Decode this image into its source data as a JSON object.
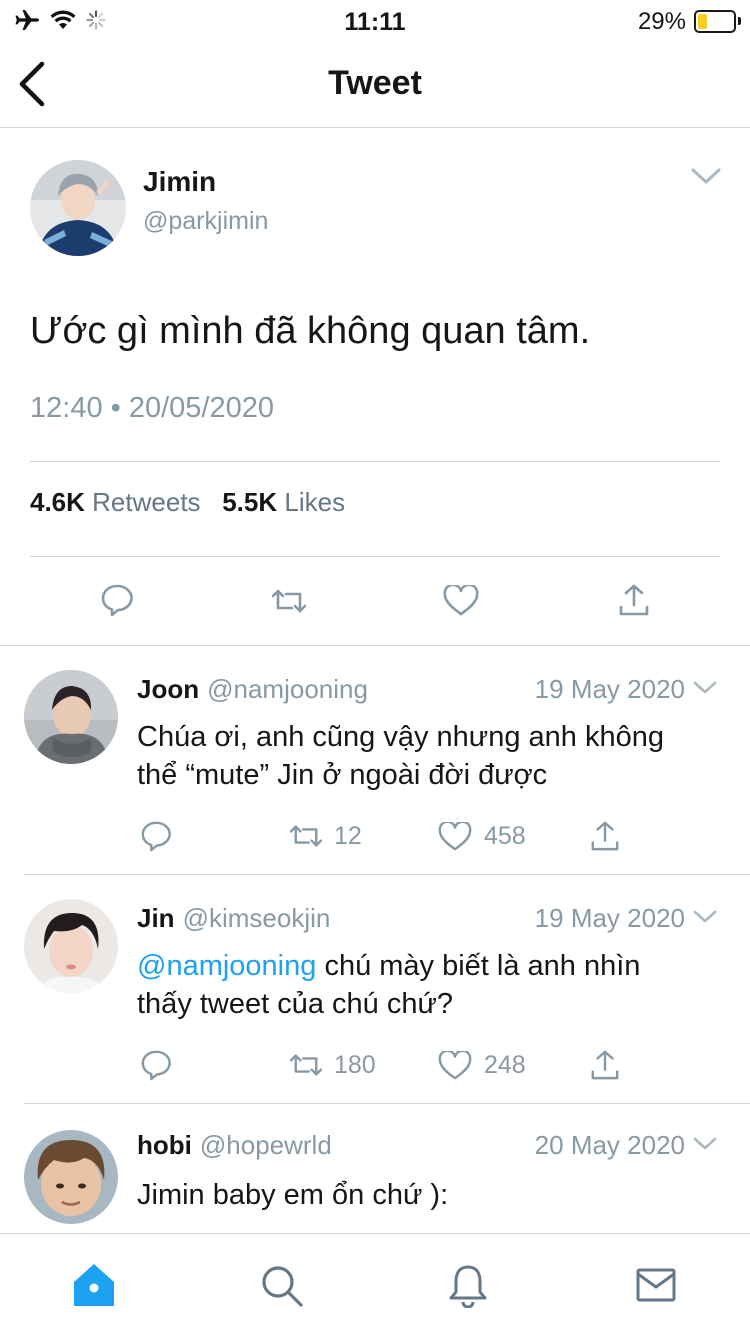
{
  "status_bar": {
    "time": "11:11",
    "battery_percent": "29%",
    "battery_level": 0.29,
    "icons": [
      "airplane-icon",
      "wifi-icon",
      "activity-spinner-icon",
      "battery-icon"
    ]
  },
  "nav": {
    "title": "Tweet",
    "back_icon": "chevron-left-icon"
  },
  "tweet": {
    "name": "Jimin",
    "handle": "@parkjimin",
    "text": "Ước gì mình đã không quan tâm.",
    "timestamp": "12:40 • 20/05/2020",
    "retweets_count": "4.6K",
    "retweets_label": "Retweets",
    "likes_count": "5.5K",
    "likes_label": "Likes",
    "actions": [
      "reply-icon",
      "retweet-icon",
      "like-icon",
      "share-icon"
    ]
  },
  "replies": [
    {
      "name": "Joon",
      "handle": "@namjooning",
      "date": "19 May 2020",
      "text_line1": "Chúa ơi, anh cũng vậy nhưng anh không",
      "text_line2": "thể “mute” Jin ở ngoài đời được",
      "retweets": "12",
      "likes": "458"
    },
    {
      "name": "Jin",
      "handle": "@kimseokjin",
      "date": "19 May 2020",
      "mention": "@namjooning",
      "text_line1": " chú mày biết là anh nhìn",
      "text_line2": "thấy tweet của chú chứ?",
      "retweets": "180",
      "likes": "248"
    },
    {
      "name": "hobi",
      "handle": "@hopewrld",
      "date": "20 May 2020",
      "text_line1": "Jimin baby em ổn chứ ):"
    }
  ],
  "tab_bar": {
    "tabs": [
      "home-icon",
      "search-icon",
      "notifications-icon",
      "messages-icon"
    ],
    "accent": "#1da1f2"
  },
  "colors": {
    "accent": "#1da1f2",
    "secondary_text": "#8899a6",
    "separator": "#cfd3d6"
  }
}
